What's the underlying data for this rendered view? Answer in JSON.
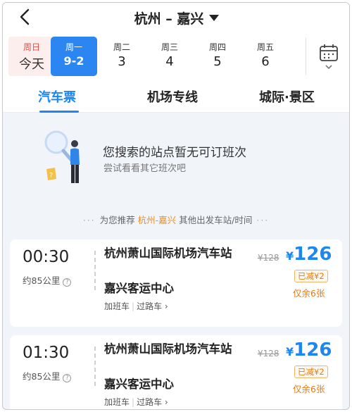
{
  "header": {
    "title": "杭州 – 嘉兴"
  },
  "dates": [
    {
      "week": "周日",
      "date": "今天"
    },
    {
      "week": "周一",
      "date": "9-2"
    },
    {
      "week": "周二",
      "date": "3"
    },
    {
      "week": "周三",
      "date": "4"
    },
    {
      "week": "周四",
      "date": "5"
    },
    {
      "week": "周五",
      "date": "6"
    }
  ],
  "tabs": [
    "汽车票",
    "机场专线",
    "城际·景区"
  ],
  "empty": {
    "title": "您搜索的站点暂无可订班次",
    "subtitle": "尝试看看其它班次吧"
  },
  "recommend": {
    "prefix": "为您推荐",
    "route": "杭州-嘉兴",
    "suffix": "其他出发车站/时间"
  },
  "trips": [
    {
      "time": "00:30",
      "distance": "约85公里",
      "from": "杭州萧山国际机场汽车站",
      "to": "嘉兴客运中心",
      "tag1": "加班车",
      "tag2": "过路车",
      "original_price": "¥128",
      "currency": "¥",
      "price": "126",
      "discount": "已减¥2",
      "remaining": "仅余6张"
    },
    {
      "time": "01:30",
      "distance": "约85公里",
      "from": "杭州萧山国际机场汽车站",
      "to": "嘉兴客运中心",
      "tag1": "加班车",
      "tag2": "过路车",
      "original_price": "¥128",
      "currency": "¥",
      "price": "126",
      "discount": "已减¥2",
      "remaining": "仅余6张"
    }
  ],
  "colors": {
    "accent": "#1e86f0",
    "highlight": "#f08a1c",
    "today": "#e34b3f"
  },
  "icons": [
    "back-arrow-icon",
    "dropdown-caret-icon",
    "calendar-icon",
    "chevron-down-icon",
    "search-person-icon",
    "info-icon",
    "chevron-right-icon"
  ]
}
